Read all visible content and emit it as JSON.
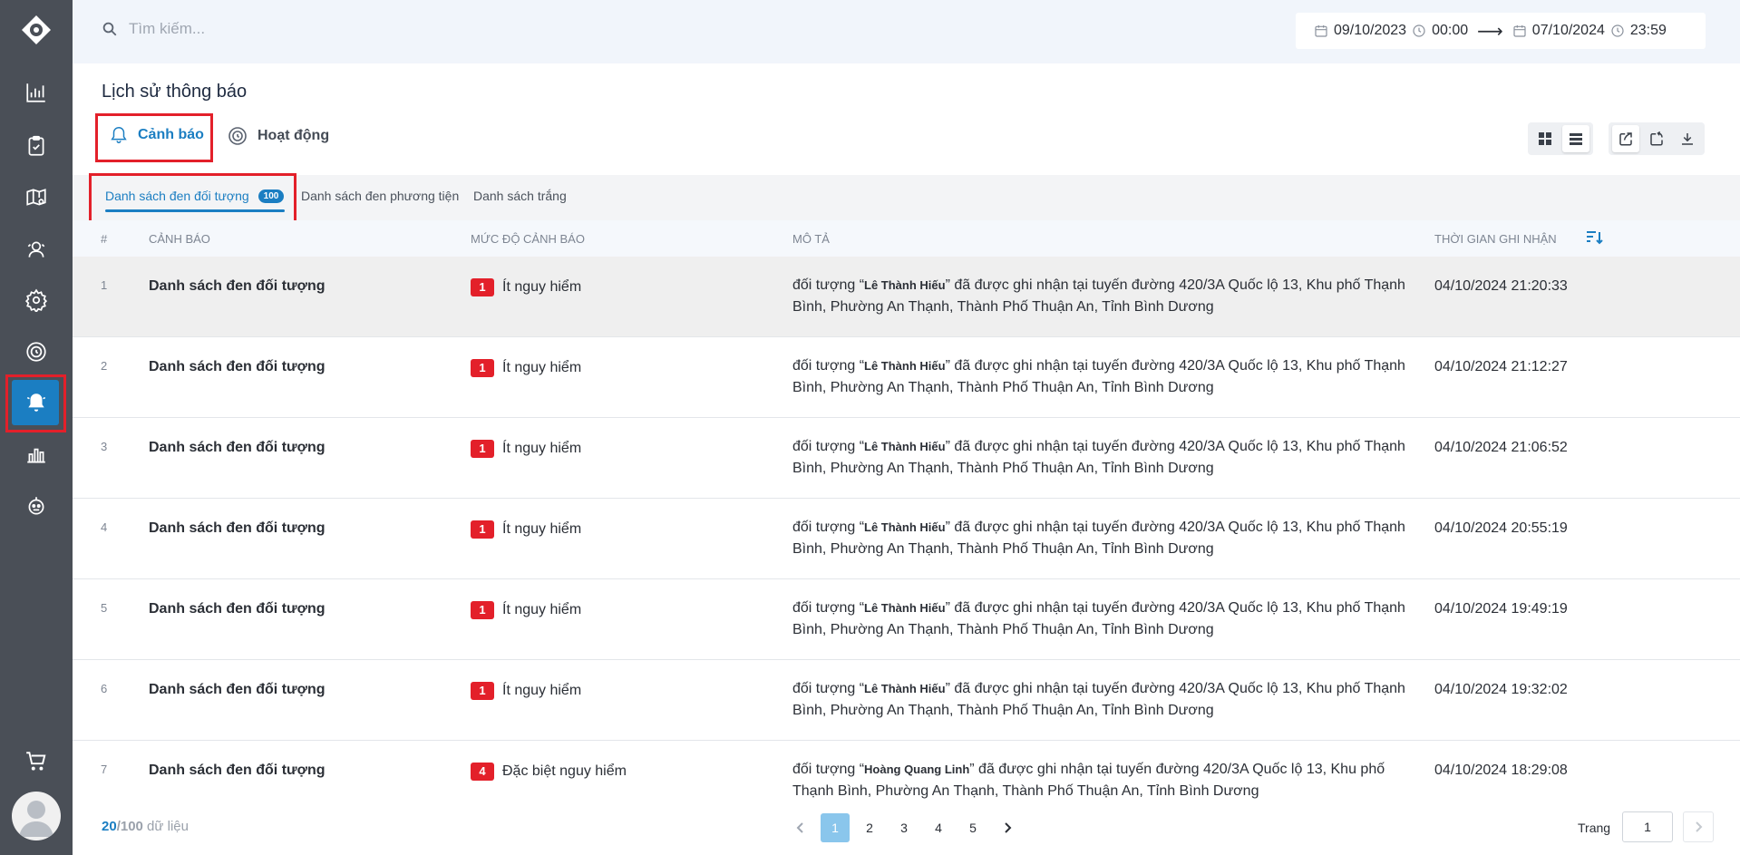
{
  "search": {
    "placeholder": "Tìm kiếm..."
  },
  "date_range": {
    "from_date": "09/10/2023",
    "from_time": "00:00",
    "arrow": "⟶",
    "to_date": "07/10/2024",
    "to_time": "23:59"
  },
  "page_title": "Lịch sử thông báo",
  "main_tabs": [
    {
      "label": "Cảnh báo",
      "active": true,
      "icon": "bell-outline-icon"
    },
    {
      "label": "Hoạt động",
      "active": false,
      "icon": "activity-timer-icon"
    }
  ],
  "sub_tabs": [
    {
      "label": "Danh sách đen đối tượng",
      "badge": "100",
      "active": true
    },
    {
      "label": "Danh sách đen phương tiện"
    },
    {
      "label": "Danh sách trắng"
    }
  ],
  "table": {
    "headers": {
      "index": "#",
      "alert": "CẢNH BÁO",
      "level": "MỨC ĐỘ CẢNH BÁO",
      "desc": "MÔ TẢ",
      "time": "THỜI GIAN GHI NHẬN"
    },
    "rows": [
      {
        "index": "1",
        "alert": "Danh sách đen đối tượng",
        "level_num": "1",
        "level_text": "Ít nguy hiểm",
        "desc_prefix": "đối tượng “",
        "desc_name": "Lê Thành Hiếu",
        "desc_suffix": "” đã được ghi nhận tại tuyến đường 420/3A Quốc lộ 13, Khu phố Thạnh Bình, Phường An Thạnh, Thành Phố Thuận An, Tỉnh Bình Dương",
        "time": "04/10/2024 21:20:33"
      },
      {
        "index": "2",
        "alert": "Danh sách đen đối tượng",
        "level_num": "1",
        "level_text": "Ít nguy hiểm",
        "desc_prefix": "đối tượng “",
        "desc_name": "Lê Thành Hiếu",
        "desc_suffix": "” đã được ghi nhận tại tuyến đường 420/3A Quốc lộ 13, Khu phố Thạnh Bình, Phường An Thạnh, Thành Phố Thuận An, Tỉnh Bình Dương",
        "time": "04/10/2024 21:12:27"
      },
      {
        "index": "3",
        "alert": "Danh sách đen đối tượng",
        "level_num": "1",
        "level_text": "Ít nguy hiểm",
        "desc_prefix": "đối tượng “",
        "desc_name": "Lê Thành Hiếu",
        "desc_suffix": "” đã được ghi nhận tại tuyến đường 420/3A Quốc lộ 13, Khu phố Thạnh Bình, Phường An Thạnh, Thành Phố Thuận An, Tỉnh Bình Dương",
        "time": "04/10/2024 21:06:52"
      },
      {
        "index": "4",
        "alert": "Danh sách đen đối tượng",
        "level_num": "1",
        "level_text": "Ít nguy hiểm",
        "desc_prefix": "đối tượng “",
        "desc_name": "Lê Thành Hiếu",
        "desc_suffix": "” đã được ghi nhận tại tuyến đường 420/3A Quốc lộ 13, Khu phố Thạnh Bình, Phường An Thạnh, Thành Phố Thuận An, Tỉnh Bình Dương",
        "time": "04/10/2024 20:55:19"
      },
      {
        "index": "5",
        "alert": "Danh sách đen đối tượng",
        "level_num": "1",
        "level_text": "Ít nguy hiểm",
        "desc_prefix": "đối tượng “",
        "desc_name": "Lê Thành Hiếu",
        "desc_suffix": "” đã được ghi nhận tại tuyến đường 420/3A Quốc lộ 13, Khu phố Thạnh Bình, Phường An Thạnh, Thành Phố Thuận An, Tỉnh Bình Dương",
        "time": "04/10/2024 19:49:19"
      },
      {
        "index": "6",
        "alert": "Danh sách đen đối tượng",
        "level_num": "1",
        "level_text": "Ít nguy hiểm",
        "desc_prefix": "đối tượng “",
        "desc_name": "Lê Thành Hiếu",
        "desc_suffix": "” đã được ghi nhận tại tuyến đường 420/3A Quốc lộ 13, Khu phố Thạnh Bình, Phường An Thạnh, Thành Phố Thuận An, Tỉnh Bình Dương",
        "time": "04/10/2024 19:32:02"
      },
      {
        "index": "7",
        "alert": "Danh sách đen đối tượng",
        "level_num": "4",
        "level_text": "Đặc biệt nguy hiểm",
        "desc_prefix": "đối tượng “",
        "desc_name": "Hoàng Quang Linh",
        "desc_suffix": "” đã được ghi nhận tại tuyến đường 420/3A Quốc lộ 13, Khu phố Thạnh Bình, Phường An Thạnh, Thành Phố Thuận An, Tỉnh Bình Dương",
        "time": "04/10/2024 18:29:08"
      }
    ]
  },
  "footer": {
    "shown": "20",
    "total": "/100",
    "suffix": " dữ liệu",
    "pages": [
      "1",
      "2",
      "3",
      "4",
      "5"
    ],
    "current_page": "1",
    "page_label": "Trang",
    "page_input": "1"
  },
  "colors": {
    "accent": "#1b7ec2",
    "sidebar": "#4a4f57",
    "danger": "#e3202a",
    "highlight": "#e3202a"
  }
}
